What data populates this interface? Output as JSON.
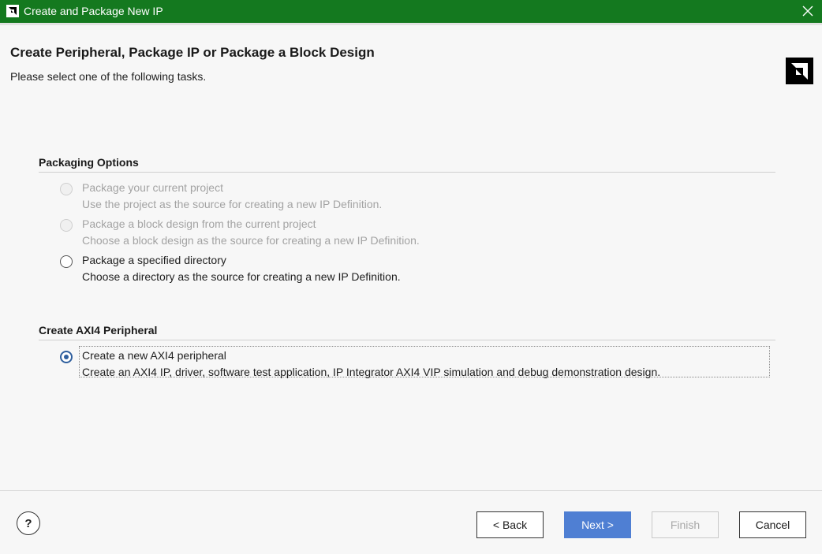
{
  "window": {
    "title": "Create and Package New IP",
    "close_icon": "close-icon",
    "titlebar_color": "#14791f"
  },
  "header": {
    "title": "Create Peripheral, Package IP or Package a Block Design",
    "subtitle": "Please select one of the following tasks."
  },
  "packaging": {
    "section_title": "Packaging Options",
    "options": [
      {
        "label": "Package your current project",
        "description": "Use the project as the source for creating a new IP Definition.",
        "enabled": false,
        "selected": false
      },
      {
        "label": "Package a block design from the current project",
        "description": "Choose a block design as the source for creating a new IP Definition.",
        "enabled": false,
        "selected": false
      },
      {
        "label": "Package a specified directory",
        "description": "Choose a directory as the source for creating a new IP Definition.",
        "enabled": true,
        "selected": false
      }
    ]
  },
  "axi": {
    "section_title": "Create AXI4 Peripheral",
    "options": [
      {
        "label": "Create a new AXI4 peripheral",
        "description": "Create an AXI4 IP, driver, software test application, IP Integrator AXI4 VIP simulation and debug demonstration design.",
        "enabled": true,
        "selected": true
      }
    ]
  },
  "footer": {
    "help_label": "?",
    "back_label": "< Back",
    "next_label": "Next >",
    "finish_label": "Finish",
    "cancel_label": "Cancel",
    "accent_color": "#4f7fd3"
  }
}
